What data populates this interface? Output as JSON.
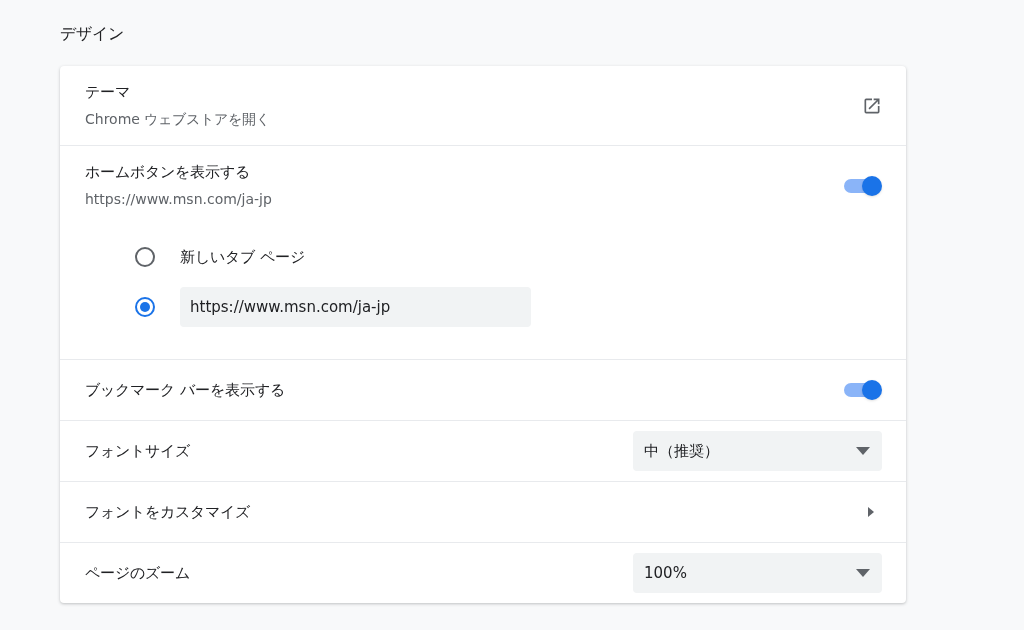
{
  "section_title": "デザイン",
  "rows": [
    {
      "kind": "link",
      "label": "テーマ",
      "sublabel": "Chrome ウェブストアを開く"
    },
    {
      "kind": "toggle",
      "label": "ホームボタンを表示する",
      "sublabel": "https://www.msn.com/ja-jp",
      "on": true,
      "options": [
        {
          "kind": "text",
          "label": "新しいタブ ページ",
          "selected": false
        },
        {
          "kind": "input",
          "value": "https://www.msn.com/ja-jp",
          "selected": true
        }
      ]
    },
    {
      "kind": "toggle",
      "label": "ブックマーク バーを表示する",
      "on": true
    },
    {
      "kind": "select",
      "label": "フォントサイズ",
      "value": "中（推奨）"
    },
    {
      "kind": "submenu",
      "label": "フォントをカスタマイズ"
    },
    {
      "kind": "select",
      "label": "ページのズーム",
      "value": "100%"
    }
  ]
}
